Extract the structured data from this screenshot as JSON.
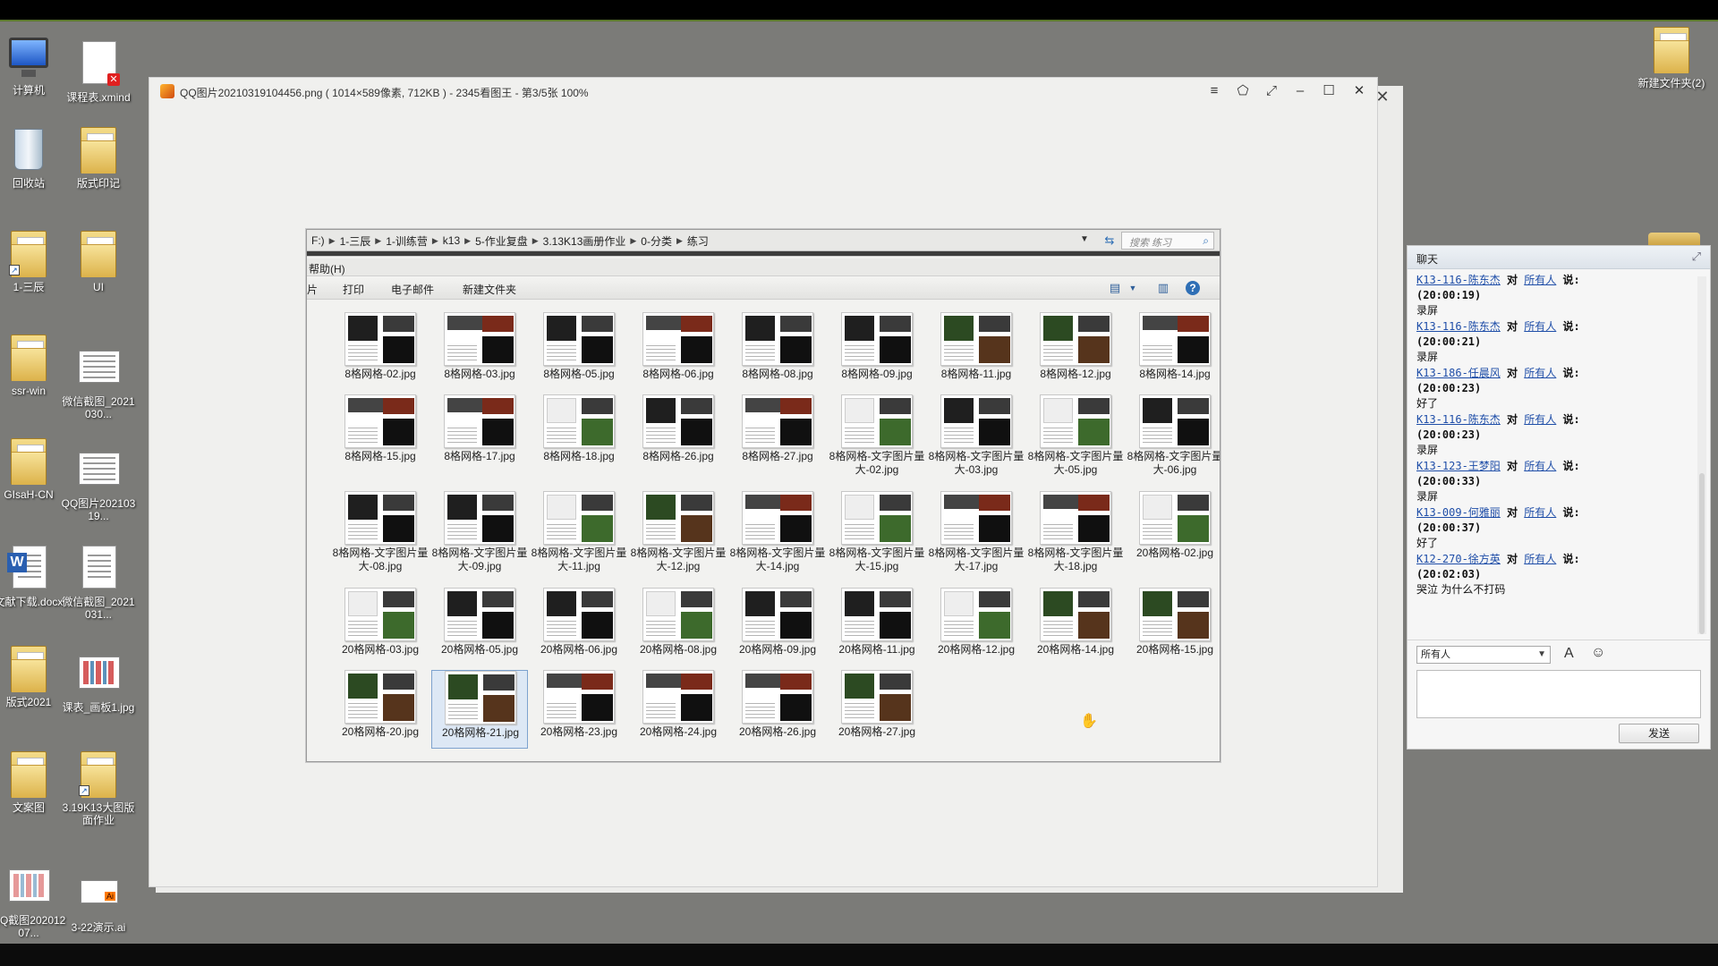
{
  "desktop": {
    "icons_left": [
      {
        "label": "计算机",
        "icon": "computer-icon"
      },
      {
        "label": "课程表.xmind",
        "icon": "xmind-file-icon"
      },
      {
        "label": "回收站",
        "icon": "recycle-bin-icon"
      },
      {
        "label": "版式印记",
        "icon": "folder-icon"
      },
      {
        "label": "1-三辰",
        "icon": "folder-shortcut-icon"
      },
      {
        "label": "UI",
        "icon": "folder-icon"
      },
      {
        "label": "ssr-win",
        "icon": "folder-icon"
      },
      {
        "label": "微信截图_2021030...",
        "icon": "image-file-icon"
      },
      {
        "label": "GIsaH-CN",
        "icon": "folder-icon"
      },
      {
        "label": "QQ图片20210319...",
        "icon": "image-file-icon"
      },
      {
        "label": "文献下载.docx",
        "icon": "word-file-icon"
      },
      {
        "label": "微信截图_2021031...",
        "icon": "image-file-icon"
      },
      {
        "label": "版式2021",
        "icon": "folder-icon"
      },
      {
        "label": "课表_画板1.jpg",
        "icon": "image-file-icon"
      },
      {
        "label": "文案图",
        "icon": "folder-icon"
      },
      {
        "label": "3.19K13大图版面作业",
        "icon": "folder-shortcut-icon"
      },
      {
        "label": "QQ截图20201207...",
        "icon": "image-file-icon"
      },
      {
        "label": "3-22演示.ai",
        "icon": "illustrator-file-icon"
      }
    ],
    "icon_right": {
      "label": "新建文件夹(2)",
      "icon": "folder-icon"
    }
  },
  "viewer": {
    "title": "QQ图片20210319104456.png ( 1014×589像素, 712KB ) - 2345看图王 - 第3/5张 100%",
    "buttons": [
      "≡",
      "⬠",
      "⤢",
      "–",
      "☐",
      "✕"
    ],
    "outer_close": "✕"
  },
  "explorer": {
    "breadcrumb": [
      "F:)",
      "1-三辰",
      "1-训练营",
      "k13",
      "5-作业复盘",
      "3.13K13画册作业",
      "0-分类",
      "练习"
    ],
    "search_placeholder": "搜索 练习",
    "menu_help": "帮助(H)",
    "toolbar": {
      "share": "片",
      "print": "打印",
      "email": "电子邮件",
      "new_folder": "新建文件夹"
    },
    "files": [
      "8格网格-02.jpg",
      "8格网格-03.jpg",
      "8格网格-05.jpg",
      "8格网格-06.jpg",
      "8格网格-08.jpg",
      "8格网格-09.jpg",
      "8格网格-11.jpg",
      "8格网格-12.jpg",
      "8格网格-14.jpg",
      "8格网格-15.jpg",
      "8格网格-17.jpg",
      "8格网格-18.jpg",
      "8格网格-26.jpg",
      "8格网格-27.jpg",
      "8格网格-文字图片量大-02.jpg",
      "8格网格-文字图片量大-03.jpg",
      "8格网格-文字图片量大-05.jpg",
      "8格网格-文字图片量大-06.jpg",
      "8格网格-文字图片量大-08.jpg",
      "8格网格-文字图片量大-09.jpg",
      "8格网格-文字图片量大-11.jpg",
      "8格网格-文字图片量大-12.jpg",
      "8格网格-文字图片量大-14.jpg",
      "8格网格-文字图片量大-15.jpg",
      "8格网格-文字图片量大-17.jpg",
      "8格网格-文字图片量大-18.jpg",
      "20格网格-02.jpg",
      "20格网格-03.jpg",
      "20格网格-05.jpg",
      "20格网格-06.jpg",
      "20格网格-08.jpg",
      "20格网格-09.jpg",
      "20格网格-11.jpg",
      "20格网格-12.jpg",
      "20格网格-14.jpg",
      "20格网格-15.jpg",
      "20格网格-20.jpg",
      "20格网格-21.jpg",
      "20格网格-23.jpg",
      "20格网格-24.jpg",
      "20格网格-26.jpg",
      "20格网格-27.jpg"
    ],
    "selected_file": "20格网格-21.jpg"
  },
  "chat": {
    "title": "聊天",
    "messages": [
      {
        "sender": "K13-116-陈东杰",
        "to": "所有人",
        "say": "说:",
        "time": "(20:00:19)",
        "body": "录屏"
      },
      {
        "sender": "K13-116-陈东杰",
        "to": "所有人",
        "say": "说:",
        "time": "(20:00:21)",
        "body": "录屏"
      },
      {
        "sender": "K13-186-任晨风",
        "to": "所有人",
        "say": "说:",
        "time": "(20:00:23)",
        "body": "好了"
      },
      {
        "sender": "K13-116-陈东杰",
        "to": "所有人",
        "say": "说:",
        "time": "(20:00:23)",
        "body": "录屏"
      },
      {
        "sender": "K13-123-王梦阳",
        "to": "所有人",
        "say": "说:",
        "time": "(20:00:33)",
        "body": "录屏"
      },
      {
        "sender": "K13-009-何雅丽",
        "to": "所有人",
        "say": "说:",
        "time": "(20:00:37)",
        "body": "好了"
      },
      {
        "sender": "K12-270-徐方英",
        "to": "所有人",
        "say": "说:",
        "time": "(20:02:03)",
        "body": "哭泣 为什么不打码"
      }
    ],
    "connector": "对",
    "target": "所有人",
    "send_label": "发送"
  }
}
